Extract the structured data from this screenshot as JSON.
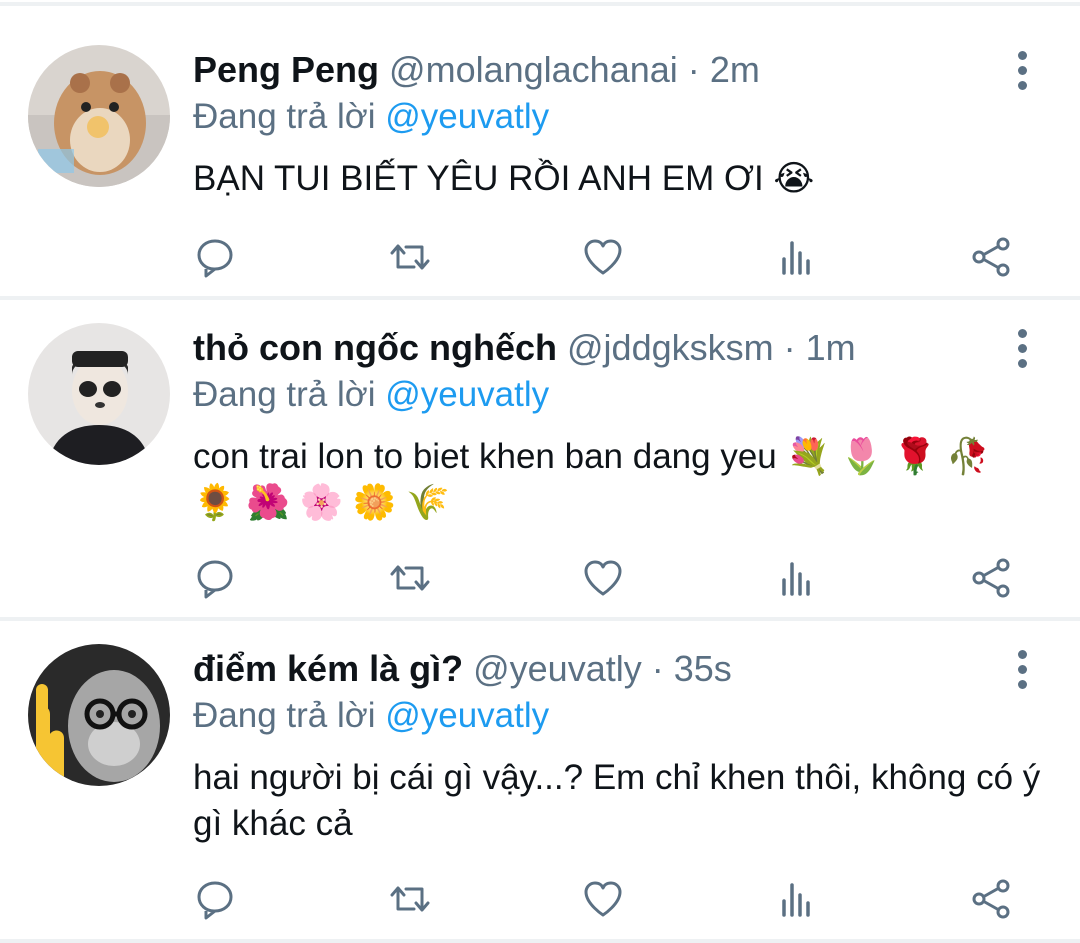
{
  "tweets": [
    {
      "name": "Peng Peng",
      "handle": "@molanglachanai",
      "separator": "·",
      "time": "2m",
      "reply_prefix": "Đang trả lời",
      "reply_mention": "@yeuvatly",
      "text": "BẠN TUI BIẾT YÊU RỒI ANH EM ƠI 😭"
    },
    {
      "name": "thỏ con ngốc nghếch",
      "handle": "@jddgksksm",
      "separator": "·",
      "time": "1m",
      "reply_prefix": "Đang trả lời",
      "reply_mention": "@yeuvatly",
      "text": "con trai lon to biet khen ban dang yeu 💐 🌷 🌹 🥀 🌻 🌺 🌸 🌼 🌾"
    },
    {
      "name": "điểm kém là gì?",
      "handle": "@yeuvatly",
      "separator": "·",
      "time": "35s",
      "reply_prefix": "Đang trả lời",
      "reply_mention": "@yeuvatly",
      "text": "hai người bị cái gì vậy...? Em chỉ khen thôi, không có ý gì khác cả"
    }
  ],
  "icons": {
    "reply": "reply-icon",
    "retweet": "retweet-icon",
    "like": "like-icon",
    "analytics": "analytics-icon",
    "share": "share-icon",
    "more": "more-options-icon"
  },
  "colors": {
    "icon_gray": "#5b7083",
    "mention_blue": "#1d9bf0",
    "separator": "#eef1f3"
  }
}
